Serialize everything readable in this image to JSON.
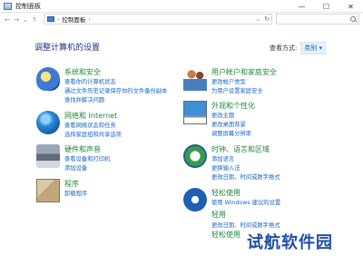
{
  "window": {
    "title": "控制面板",
    "controls": {
      "minimize": "—",
      "maximize": "☐",
      "close": "✕"
    }
  },
  "address": {
    "path": "控制面板",
    "nav": {
      "back": "←",
      "forward": "→",
      "recent": "⌄",
      "up": "↑"
    },
    "dropdown": "⌄",
    "refresh": "↻",
    "search_placeholder": ""
  },
  "header": {
    "title": "调整计算机的设置",
    "view_by_label": "查看方式:",
    "view_by_value": "类别 ▾"
  },
  "categories": [
    {
      "id": "system-security",
      "icon": "shield-icon",
      "title": "系统和安全",
      "links": [
        "查看你的计算机状态",
        "通过文件历史记录保存你的文件备份副本",
        "查找并解决问题"
      ]
    },
    {
      "id": "network-internet",
      "icon": "globe-icon",
      "title": "网络和 Internet",
      "links": [
        "查看网络状态和任务",
        "选择家庭组和共享选项"
      ]
    },
    {
      "id": "hardware-sound",
      "icon": "printer-icon",
      "title": "硬件和声音",
      "links": [
        "查看设备和打印机",
        "添加设备"
      ]
    },
    {
      "id": "programs",
      "icon": "program-box-icon",
      "title": "程序",
      "links": [
        "卸载程序"
      ]
    },
    {
      "id": "user-accounts",
      "icon": "users-icon",
      "title": "用户帐户和家庭安全",
      "links": [
        "更改帐户类型",
        "为用户设置家庭安全"
      ]
    },
    {
      "id": "appearance",
      "icon": "monitor-icon",
      "title": "外观和个性化",
      "links": [
        "更改主题",
        "更改桌面背景",
        "调整屏幕分辨率"
      ]
    },
    {
      "id": "clock-region",
      "icon": "clock-globe-icon",
      "title": "时钟、语言和区域",
      "links": [
        "添加语言",
        "更换输入法",
        "更改日期、时间或数字格式"
      ]
    },
    {
      "id": "ease-of-access",
      "icon": "accessibility-icon",
      "title": "轻松使用",
      "links": [
        "使用 Windows 建议的设置",
        "轻用",
        "更改日期、时间或数字格式",
        "轻松使用"
      ]
    }
  ],
  "watermark": "试航软件园"
}
